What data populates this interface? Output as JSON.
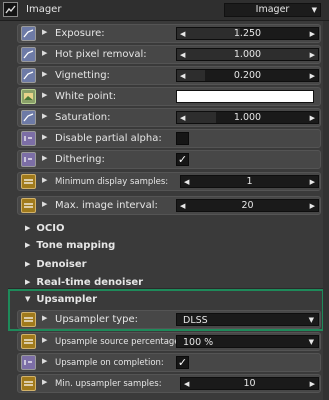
{
  "header": {
    "title": "Imager",
    "mode_value": "Imager"
  },
  "rows": {
    "exposure": {
      "label": "Exposure:",
      "value": "1.250"
    },
    "hot_pixel": {
      "label": "Hot pixel removal:",
      "value": "1.000"
    },
    "vignetting": {
      "label": "Vignetting:",
      "value": "0.200"
    },
    "white_point": {
      "label": "White point:",
      "color": "#ffffff"
    },
    "saturation": {
      "label": "Saturation:",
      "value": "1.000"
    },
    "disable_alpha": {
      "label": "Disable partial alpha:",
      "checked": false
    },
    "dithering": {
      "label": "Dithering:",
      "checked": true,
      "mark": "✓"
    },
    "min_display": {
      "label": "Minimum display samples:",
      "value": "1"
    },
    "max_interval": {
      "label": "Max. image interval:",
      "value": "20"
    }
  },
  "sections": {
    "ocio": "OCIO",
    "tone": "Tone mapping",
    "denoiser": "Denoiser",
    "realtime": "Real-time denoiser",
    "upsampler": "Upsampler"
  },
  "upsampler": {
    "type": {
      "label": "Upsampler type:",
      "value": "DLSS"
    },
    "source_pct": {
      "label": "Upsample source percentage:",
      "value": "100 %"
    },
    "on_completion": {
      "label": "Upsample on completion:",
      "checked": true,
      "mark": "✓"
    },
    "min_samples": {
      "label": "Min. upsampler samples:",
      "value": "10"
    }
  }
}
